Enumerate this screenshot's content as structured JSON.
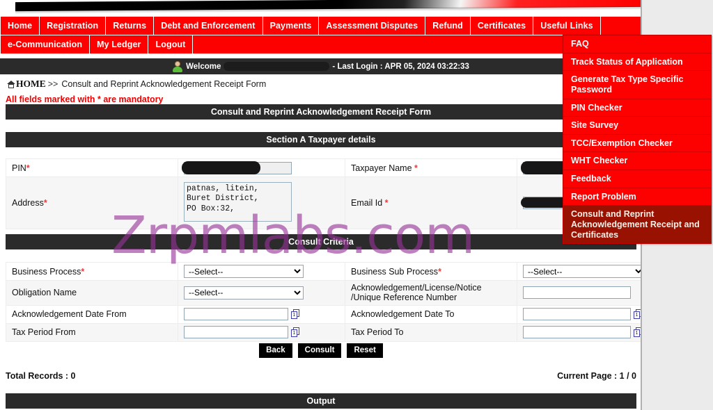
{
  "theme": {
    "brand_red": "#fd0000",
    "dark_bar": "#2b2b2b",
    "active_menu": "#991100",
    "required_star": "#ee3a3a",
    "watermark_color": "#963296"
  },
  "nav": {
    "row1": [
      {
        "label": "Home"
      },
      {
        "label": "Registration"
      },
      {
        "label": "Returns"
      },
      {
        "label": "Debt and Enforcement"
      },
      {
        "label": "Payments"
      },
      {
        "label": "Assessment Disputes"
      },
      {
        "label": "Refund"
      },
      {
        "label": "Certificates"
      },
      {
        "label": "Useful Links"
      }
    ],
    "row2": [
      {
        "label": "e-Communication"
      },
      {
        "label": "My Ledger"
      },
      {
        "label": "Logout"
      }
    ]
  },
  "dropdown": {
    "items": [
      {
        "label": "FAQ",
        "active": false
      },
      {
        "label": "Track Status of Application",
        "active": false
      },
      {
        "label": "Generate Tax Type Specific Password",
        "active": false
      },
      {
        "label": "PIN Checker",
        "active": false
      },
      {
        "label": "Site Survey",
        "active": false
      },
      {
        "label": "TCC/Exemption Checker",
        "active": false
      },
      {
        "label": "WHT Checker",
        "active": false
      },
      {
        "label": "Feedback",
        "active": false
      },
      {
        "label": "Report Problem",
        "active": false
      },
      {
        "label": "Consult and Reprint Acknowledgement Receipt and Certificates",
        "active": true
      }
    ]
  },
  "welcome": {
    "greeting": "Welcome",
    "user_name": "",
    "last_login": "- Last Login : APR 05, 2024 03:22:33"
  },
  "breadcrumb": {
    "home": "HOME",
    "separator": ">>",
    "current": "Consult and Reprint Acknowledgement Receipt Form"
  },
  "notice": {
    "mandatory": "All fields marked with * are mandatory"
  },
  "sections": {
    "form_title": "Consult and Reprint Acknowledgement Receipt Form",
    "section_a": "Section A Taxpayer details",
    "consult_criteria": "Consult Criteria",
    "output": "Output"
  },
  "taxpayer": {
    "pin_label": "PIN",
    "pin_value": "",
    "taxpayer_name_label": "Taxpayer Name",
    "taxpayer_name_value": "",
    "address_label": "Address",
    "address_value": "patnas, litein,\nBuret District,\nPO Box:32,",
    "email_label": "Email Id",
    "email_value": ""
  },
  "criteria": {
    "business_process_label": "Business Process",
    "business_process_value": "--Select--",
    "business_sub_process_label": "Business Sub Process",
    "business_sub_process_value": "--Select--",
    "obligation_name_label": "Obligation Name",
    "obligation_name_value": "--Select--",
    "ack_ref_label": "Acknowledgement/License/Notice /Unique Reference Number",
    "ack_ref_value": "",
    "ack_date_from_label": "Acknowledgement Date From",
    "ack_date_from_value": "",
    "ack_date_to_label": "Acknowledgement Date To",
    "ack_date_to_value": "",
    "tax_period_from_label": "Tax Period From",
    "tax_period_from_value": "",
    "tax_period_to_label": "Tax Period To",
    "tax_period_to_value": "",
    "select_placeholder": "--Select--"
  },
  "buttons": {
    "back": "Back",
    "consult": "Consult",
    "reset": "Reset"
  },
  "records": {
    "total": "Total Records : 0",
    "current_page": "Current Page : 1 / 0"
  },
  "watermark": {
    "text": "Zrpmlabs.com"
  }
}
